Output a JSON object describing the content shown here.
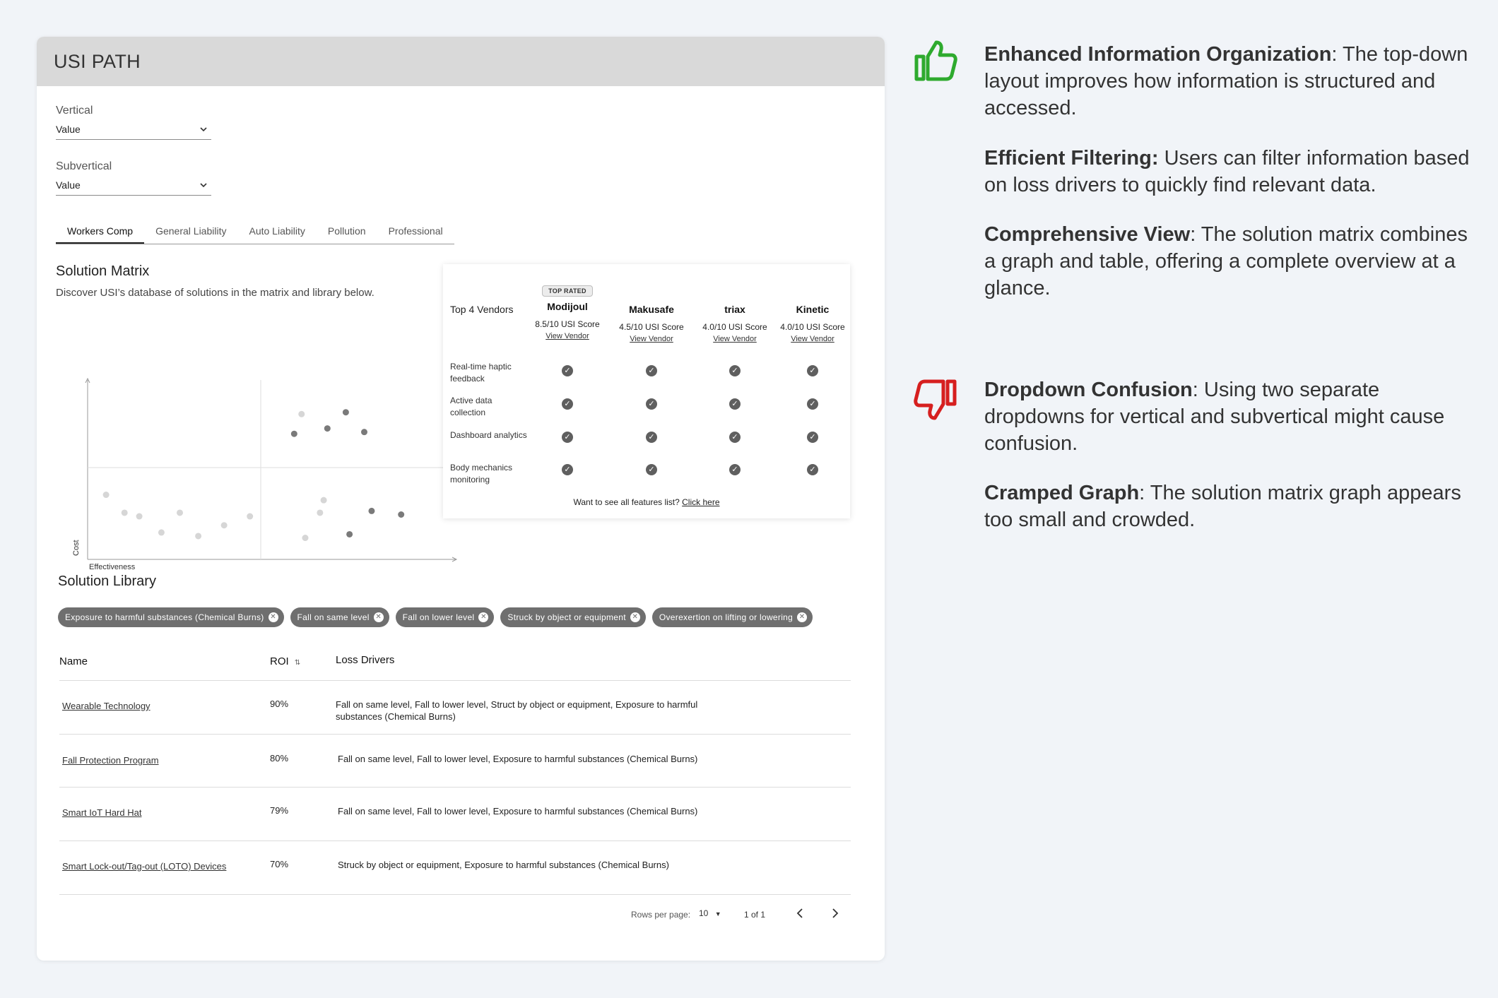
{
  "app": {
    "title": "USI PATH"
  },
  "filters": {
    "vertical": {
      "label": "Vertical",
      "value": "Value"
    },
    "subvertical": {
      "label": "Subvertical",
      "value": "Value"
    }
  },
  "tabs": [
    {
      "label": "Workers Comp",
      "active": true
    },
    {
      "label": "General Liability",
      "active": false
    },
    {
      "label": "Auto Liability",
      "active": false
    },
    {
      "label": "Pollution",
      "active": false
    },
    {
      "label": "Professional",
      "active": false
    }
  ],
  "solution_matrix": {
    "title": "Solution Matrix",
    "subtitle": "Discover USI’s database of solutions in the matrix and library below."
  },
  "chart_data": {
    "type": "scatter",
    "title": "",
    "xlabel": "Effectiveness",
    "ylabel": "Cost",
    "quadrants": true,
    "grid": false,
    "xlim": [
      0,
      100
    ],
    "ylim": [
      0,
      100
    ],
    "series": [
      {
        "color": "#d6d6d6",
        "points": [
          {
            "x": 5,
            "y": 36
          },
          {
            "x": 10,
            "y": 26
          },
          {
            "x": 14,
            "y": 24
          },
          {
            "x": 20,
            "y": 15
          },
          {
            "x": 25,
            "y": 26
          },
          {
            "x": 30,
            "y": 13
          },
          {
            "x": 37,
            "y": 19
          },
          {
            "x": 44,
            "y": 24
          },
          {
            "x": 58,
            "y": 81
          },
          {
            "x": 59,
            "y": 12
          },
          {
            "x": 63,
            "y": 26
          },
          {
            "x": 64,
            "y": 33
          }
        ]
      },
      {
        "color": "#7a7a7a",
        "points": [
          {
            "x": 56,
            "y": 70
          },
          {
            "x": 65,
            "y": 73
          },
          {
            "x": 70,
            "y": 82
          },
          {
            "x": 75,
            "y": 71
          },
          {
            "x": 71,
            "y": 14
          },
          {
            "x": 77,
            "y": 27
          },
          {
            "x": 85,
            "y": 25
          }
        ]
      }
    ]
  },
  "vendors": {
    "heading": "Top 4 Vendors",
    "badge": "TOP RATED",
    "link_label": "View Vendor",
    "list": [
      {
        "name": "Modijoul",
        "score": "8.5/10 USI Score",
        "top": true
      },
      {
        "name": "Makusafe",
        "score": "4.5/10 USI Score",
        "top": false
      },
      {
        "name": "triax",
        "score": "4.0/10 USI Score",
        "top": false
      },
      {
        "name": "Kinetic",
        "score": "4.0/10 USI Score",
        "top": false
      }
    ],
    "features": [
      "Real-time haptic feedback",
      "Active data collection",
      "Dashboard analytics",
      "Body mechanics monitoring"
    ],
    "check_icon": "check-circle-icon",
    "footer_text": "Want to see all features list?",
    "footer_link": "Click here"
  },
  "library": {
    "title": "Solution Library",
    "chips": [
      "Exposure to harmful substances (Chemical Burns)",
      "Fall on same level",
      "Fall on lower level",
      "Struck by object or equipment",
      "Overexertion on lifting or lowering"
    ],
    "columns": {
      "name": "Name",
      "roi": "ROI",
      "roi_sort": "⇅",
      "drivers": "Loss Drivers"
    },
    "rows": [
      {
        "name": "Wearable Technology",
        "roi": "90%",
        "drivers": "Fall on same level, Fall to lower level, Struct by object or equipment, Exposure to harmful substances (Chemical Burns)"
      },
      {
        "name": "Fall Protection Program",
        "roi": "80%",
        "drivers": "Fall on same level, Fall to lower level, Exposure to harmful substances (Chemical Burns)"
      },
      {
        "name": "Smart IoT Hard Hat",
        "roi": "79%",
        "drivers": "Fall on same level, Fall to lower level, Exposure to harmful substances (Chemical Burns)"
      },
      {
        "name": "Smart Lock-out/Tag-out (LOTO) Devices",
        "roi": "70%",
        "drivers": "Struck by object or equipment, Exposure to harmful substances (Chemical Burns)"
      }
    ],
    "pagination": {
      "rows_label": "Rows per page:",
      "rows_value": "10",
      "range": "1 of 1"
    }
  },
  "annotations": {
    "pros_icon": "thumbs-up-icon",
    "cons_icon": "thumbs-down-icon",
    "pros_color": "#2eaa2e",
    "cons_color": "#d61f1f",
    "pros": [
      {
        "title": "Enhanced Information Organization",
        "sep": ": ",
        "text": "The top-down layout improves how information is structured and accessed."
      },
      {
        "title": "Efficient Filtering:",
        "sep": " ",
        "text": "Users can filter information based on loss drivers to quickly find relevant data."
      },
      {
        "title": "Comprehensive View",
        "sep": ": ",
        "text": "The solution matrix combines a graph and table, offering a complete overview at a glance."
      }
    ],
    "cons": [
      {
        "title": "Dropdown Confusion",
        "sep": ": ",
        "text": "Using two separate dropdowns for vertical and subvertical might cause confusion."
      },
      {
        "title": "Cramped Graph",
        "sep": ": ",
        "text": "The solution matrix graph appears too small and crowded."
      }
    ]
  }
}
